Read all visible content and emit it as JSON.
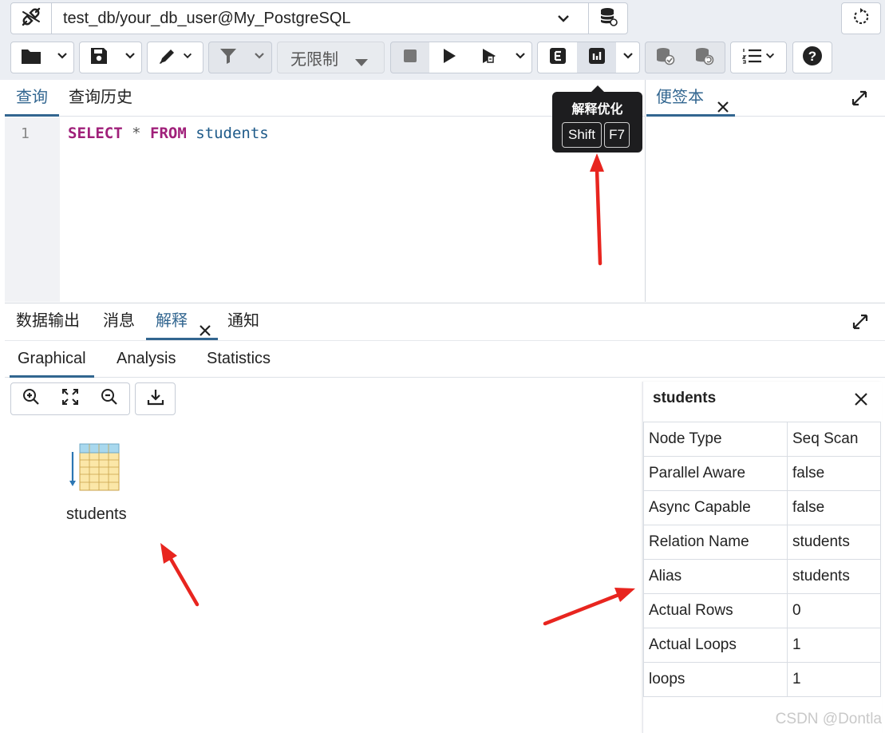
{
  "connection": {
    "label": "test_db/your_db_user@My_PostgreSQL"
  },
  "toolbar": {
    "limit_label": "无限制"
  },
  "editor": {
    "tabs": [
      {
        "label": "查询",
        "active": true
      },
      {
        "label": "查询历史",
        "active": false
      }
    ],
    "line_number": "1",
    "code": {
      "kw1": "SELECT",
      "op": "*",
      "kw2": "FROM",
      "table": "students"
    }
  },
  "tooltip": {
    "title": "解释优化",
    "key1": "Shift",
    "key2": "F7"
  },
  "scratch": {
    "tab_label": "便签本"
  },
  "output": {
    "tabs": [
      {
        "label": "数据输出"
      },
      {
        "label": "消息"
      },
      {
        "label": "解释",
        "active": true
      },
      {
        "label": "通知"
      }
    ],
    "subtabs": [
      {
        "label": "Graphical",
        "active": true
      },
      {
        "label": "Analysis"
      },
      {
        "label": "Statistics"
      }
    ],
    "node_label": "students"
  },
  "details": {
    "title": "students",
    "rows": [
      {
        "key": "Node Type",
        "value": "Seq Scan"
      },
      {
        "key": "Parallel Aware",
        "value": "false"
      },
      {
        "key": "Async Capable",
        "value": "false"
      },
      {
        "key": "Relation Name",
        "value": "students"
      },
      {
        "key": "Alias",
        "value": "students"
      },
      {
        "key": "Actual Rows",
        "value": "0"
      },
      {
        "key": "Actual Loops",
        "value": "1"
      },
      {
        "key": "loops",
        "value": "1"
      }
    ]
  },
  "watermark": "CSDN @Dontla",
  "colors": {
    "accent": "#326690",
    "keyword": "#a0207a",
    "annotation_arrow": "#e8251f"
  }
}
